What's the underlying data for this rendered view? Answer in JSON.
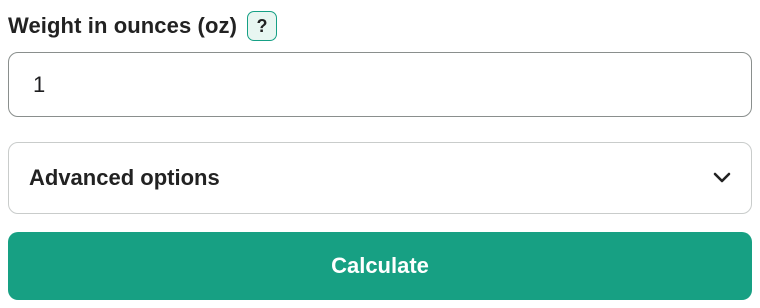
{
  "weight_field": {
    "label": "Weight in ounces (oz)",
    "help_label": "?",
    "value": "1"
  },
  "advanced": {
    "label": "Advanced options",
    "icon": "chevron-down-icon"
  },
  "calculate": {
    "label": "Calculate"
  },
  "colors": {
    "accent": "#17a083",
    "help_bg": "#e8f6f1",
    "input_border": "#8a8f8d",
    "panel_border": "#c9cccb"
  }
}
